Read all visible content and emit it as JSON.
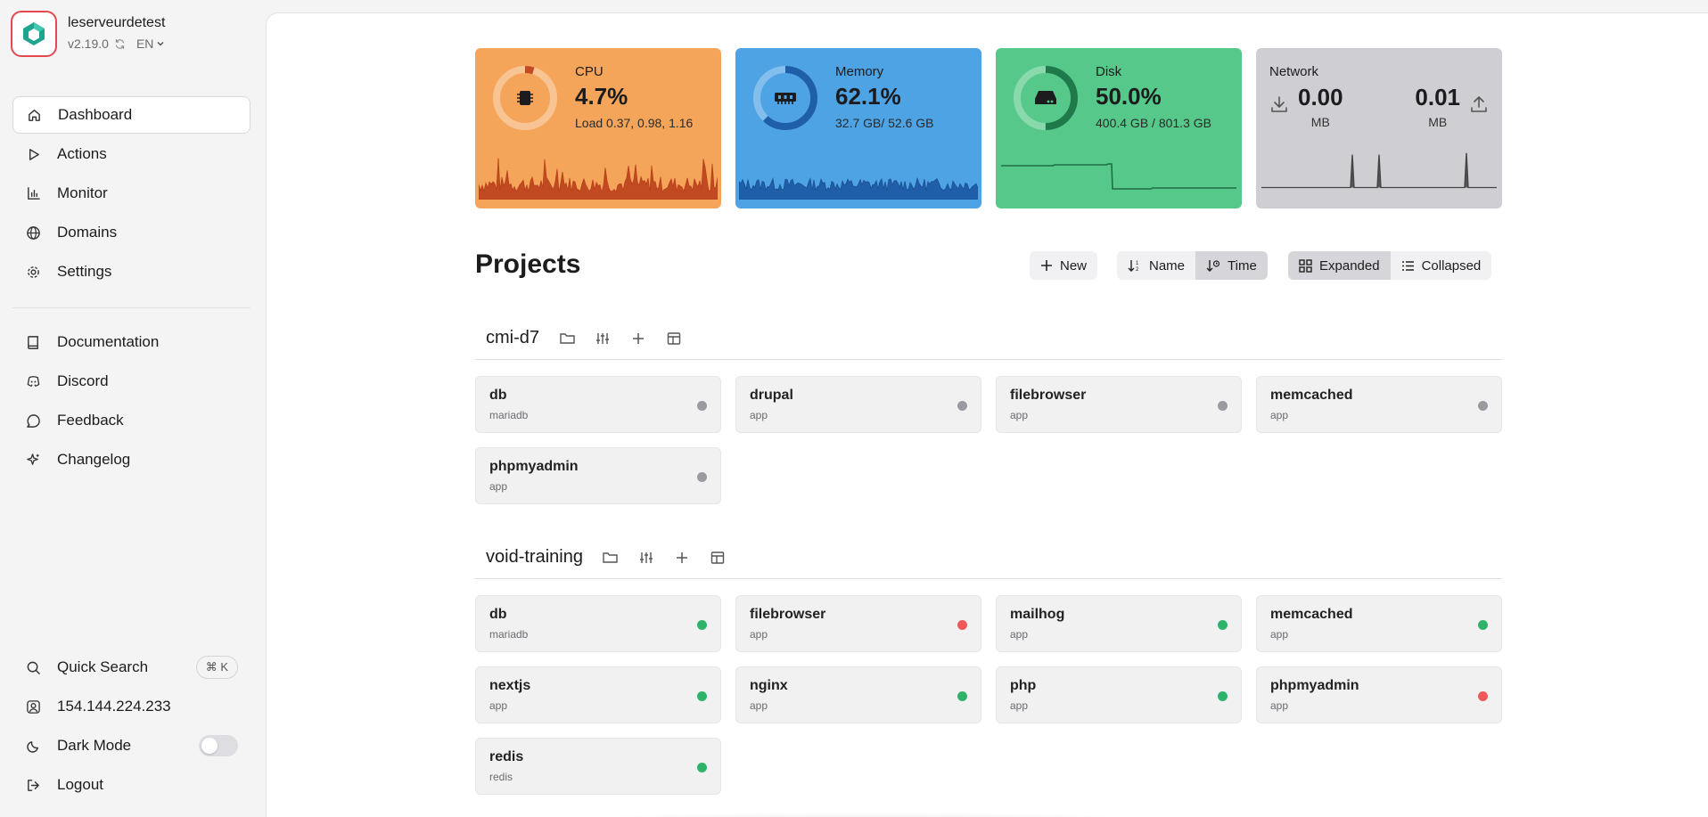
{
  "brand": {
    "name": "leserveurdetest",
    "version": "v2.19.0",
    "lang": "EN",
    "accent": "#e5484d"
  },
  "nav_primary": [
    {
      "label": "Dashboard",
      "icon": "home-icon",
      "active": true
    },
    {
      "label": "Actions",
      "icon": "play-icon"
    },
    {
      "label": "Monitor",
      "icon": "bar-chart-icon"
    },
    {
      "label": "Domains",
      "icon": "globe-icon"
    },
    {
      "label": "Settings",
      "icon": "gear-icon"
    }
  ],
  "nav_secondary": [
    {
      "label": "Documentation",
      "icon": "book-icon"
    },
    {
      "label": "Discord",
      "icon": "discord-icon"
    },
    {
      "label": "Feedback",
      "icon": "message-icon"
    },
    {
      "label": "Changelog",
      "icon": "sparkle-icon"
    }
  ],
  "nav_bottom": {
    "quick_search": "Quick Search",
    "shortcut": "⌘ K",
    "ip": "154.144.224.233",
    "dark_mode": "Dark Mode",
    "dark_mode_on": false,
    "logout": "Logout"
  },
  "stats": {
    "cpu": {
      "title": "CPU",
      "value": "4.7%",
      "sub": "Load 0.37, 0.98, 1.16",
      "percent": 4.7,
      "color": "#f4a55a"
    },
    "memory": {
      "title": "Memory",
      "value": "62.1%",
      "sub": "32.7 GB/ 52.6 GB",
      "percent": 62.1,
      "color": "#4ea3e4"
    },
    "disk": {
      "title": "Disk",
      "value": "50.0%",
      "sub": "400.4 GB / 801.3 GB",
      "percent": 50.0,
      "color": "#56c98a"
    },
    "network": {
      "title": "Network",
      "in_value": "0.00",
      "in_unit": "MB",
      "out_value": "0.01",
      "out_unit": "MB",
      "color": "#cfcfd3"
    }
  },
  "projects": {
    "title": "Projects",
    "new_label": "New",
    "sort_name": "Name",
    "sort_time": "Time",
    "view_expanded": "Expanded",
    "view_collapsed": "Collapsed",
    "sort_selected": "Time",
    "view_selected": "Expanded"
  },
  "sections": [
    {
      "name": "cmi-d7",
      "services": [
        {
          "name": "db",
          "type": "mariadb",
          "status": "stopped"
        },
        {
          "name": "drupal",
          "type": "app",
          "status": "stopped"
        },
        {
          "name": "filebrowser",
          "type": "app",
          "status": "stopped"
        },
        {
          "name": "memcached",
          "type": "app",
          "status": "stopped"
        },
        {
          "name": "phpmyadmin",
          "type": "app",
          "status": "stopped"
        }
      ]
    },
    {
      "name": "void-training",
      "services": [
        {
          "name": "db",
          "type": "mariadb",
          "status": "running"
        },
        {
          "name": "filebrowser",
          "type": "app",
          "status": "error"
        },
        {
          "name": "mailhog",
          "type": "app",
          "status": "running"
        },
        {
          "name": "memcached",
          "type": "app",
          "status": "running"
        },
        {
          "name": "nextjs",
          "type": "app",
          "status": "running"
        },
        {
          "name": "nginx",
          "type": "app",
          "status": "running"
        },
        {
          "name": "php",
          "type": "app",
          "status": "running"
        },
        {
          "name": "phpmyadmin",
          "type": "app",
          "status": "error"
        },
        {
          "name": "redis",
          "type": "redis",
          "status": "running"
        }
      ]
    }
  ],
  "status_colors": {
    "stopped": "#9a9aa0",
    "running": "#2fb36b",
    "error": "#ee5a5a"
  }
}
